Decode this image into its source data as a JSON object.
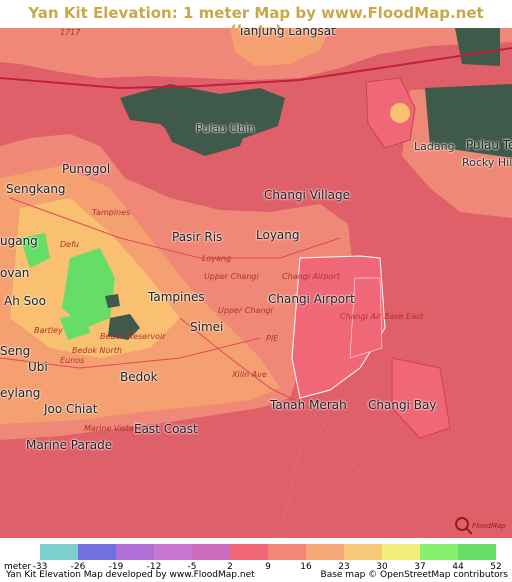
{
  "title": "Yan Kit Elevation: 1 meter Map by www.FloodMap.net (beta)",
  "colors": {
    "title": "#c9a84a",
    "sea": "#e0606a",
    "land_low": "#f08878",
    "land_mid": "#f4a070",
    "land_high": "#f8c070",
    "green_high": "#66dd66",
    "forest": "#3f5a4a"
  },
  "places": [
    {
      "key": "tanjung_langsat",
      "label": "Tanjung Langsat"
    },
    {
      "key": "pulau_ubin",
      "label": "Pulau Ubin"
    },
    {
      "key": "ladang",
      "label": "Ladang"
    },
    {
      "key": "pulau_tekong",
      "label": "Pulau Te"
    },
    {
      "key": "rocky_hill",
      "label": "Rocky Hill"
    },
    {
      "key": "punggol",
      "label": "Punggol"
    },
    {
      "key": "sengkang",
      "label": "Sengkang"
    },
    {
      "key": "changi_village",
      "label": "Changi Village"
    },
    {
      "key": "pasir_ris",
      "label": "Pasir Ris"
    },
    {
      "key": "loyang",
      "label": "Loyang"
    },
    {
      "key": "hougang",
      "label": "ugang"
    },
    {
      "key": "serangoon",
      "label": "ovan"
    },
    {
      "key": "ah_soo",
      "label": "Ah Soo"
    },
    {
      "key": "tampines",
      "label": "Tampines"
    },
    {
      "key": "changi_airport",
      "label": "Changi Airport"
    },
    {
      "key": "simei",
      "label": "Simei"
    },
    {
      "key": "geylang_serai",
      "label": "Seng"
    },
    {
      "key": "ubi",
      "label": "Ubi"
    },
    {
      "key": "bedok",
      "label": "Bedok"
    },
    {
      "key": "geylang",
      "label": "eylang"
    },
    {
      "key": "joo_chiat",
      "label": "Joo Chiat"
    },
    {
      "key": "tanah_merah",
      "label": "Tanah Merah"
    },
    {
      "key": "changi_bay",
      "label": "Changi Bay"
    },
    {
      "key": "marine_parade",
      "label": "Marine Parade"
    },
    {
      "key": "east_coast",
      "label": "East Coast"
    }
  ],
  "road_labels": [
    {
      "key": "r1717",
      "label": "1717"
    },
    {
      "key": "tampines_road",
      "label": "Tampines"
    },
    {
      "key": "defu",
      "label": "Defu"
    },
    {
      "key": "loyang_road",
      "label": "Loyang"
    },
    {
      "key": "upper_changi",
      "label": "Upper Changi"
    },
    {
      "key": "upper_changi2",
      "label": "Upper Changi"
    },
    {
      "key": "changi_airport_road",
      "label": "Changi Airport"
    },
    {
      "key": "changi_air_base",
      "label": "Changi Air Base East"
    },
    {
      "key": "bedok_reservoir",
      "label": "Bedok Reservoir"
    },
    {
      "key": "bedok_north",
      "label": "Bedok North"
    },
    {
      "key": "eunos",
      "label": "Eunos"
    },
    {
      "key": "bartley",
      "label": "Bartley"
    },
    {
      "key": "xilin",
      "label": "Xilin Ave"
    },
    {
      "key": "marine_vista",
      "label": "Marine Vista"
    },
    {
      "key": "pie",
      "label": "PIE"
    }
  ],
  "legend": {
    "unit": "meter",
    "ticks": [
      "-33",
      "-26",
      "-19",
      "-12",
      "-5",
      "2",
      "9",
      "16",
      "23",
      "30",
      "37",
      "44",
      "52"
    ],
    "colors": [
      "#7ccfcf",
      "#7070e0",
      "#b070d8",
      "#c878d0",
      "#cc6cbc",
      "#f06878",
      "#f48878",
      "#f6a878",
      "#f6c878",
      "#eeee78",
      "#88f070",
      "#66dd66"
    ]
  },
  "credits": {
    "left": "Yan Kit Elevation Map developed by www.FloodMap.net",
    "right": "Base map © OpenStreetMap contributors"
  },
  "logo_label": "FloodMap"
}
